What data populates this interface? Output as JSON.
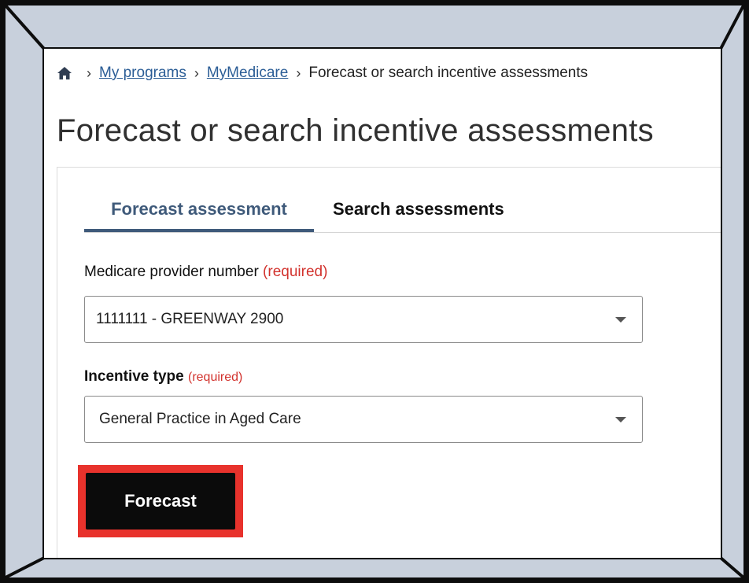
{
  "breadcrumb": {
    "home_icon": "home-icon",
    "separator": "›",
    "items": [
      {
        "label": "My programs",
        "link": true
      },
      {
        "label": "MyMedicare",
        "link": true
      },
      {
        "label": "Forecast or search incentive assessments",
        "link": false
      }
    ]
  },
  "page": {
    "title": "Forecast or search incentive assessments"
  },
  "tabs": [
    {
      "label": "Forecast assessment",
      "active": true
    },
    {
      "label": "Search assessments",
      "active": false
    }
  ],
  "form": {
    "provider": {
      "label": "Medicare provider number",
      "required": "(required)",
      "value": "1111111 - GREENWAY 2900"
    },
    "incentive": {
      "label": "Incentive type",
      "required": "(required)",
      "value": "General Practice in Aged Care"
    },
    "submit_label": "Forecast"
  },
  "colors": {
    "link": "#2b5d96",
    "active_tab": "#3f5a7a",
    "required": "#d2322d",
    "highlight": "#e8322c",
    "frame": "#c8d0dc",
    "button": "#0b0b0b"
  }
}
